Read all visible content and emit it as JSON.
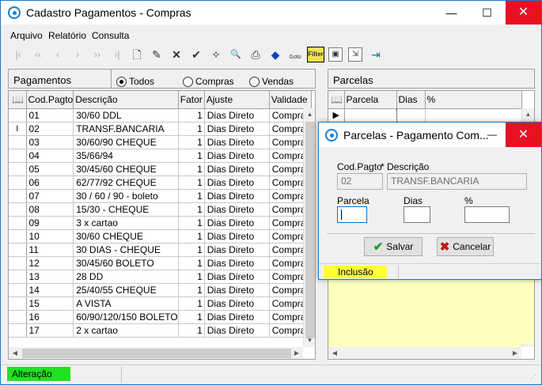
{
  "window": {
    "title": "Cadastro Pagamentos - Compras",
    "min": "—",
    "max": "☐",
    "close": "✕"
  },
  "menu": [
    {
      "label": "Arquivo"
    },
    {
      "label": "Relatório"
    },
    {
      "label": "Consulta"
    }
  ],
  "toolbar": [
    {
      "icon": "first-record-icon",
      "glyph": "|‹"
    },
    {
      "icon": "prev-page-icon",
      "glyph": "‹‹"
    },
    {
      "icon": "prev-record-icon",
      "glyph": "‹"
    },
    {
      "icon": "next-record-icon",
      "glyph": "›"
    },
    {
      "icon": "next-page-icon",
      "glyph": "››"
    },
    {
      "icon": "last-record-icon",
      "glyph": "›|"
    },
    {
      "icon": "new-icon",
      "glyph": "🗋"
    },
    {
      "icon": "edit-icon",
      "glyph": "✎"
    },
    {
      "icon": "delete-icon",
      "glyph": "✕"
    },
    {
      "icon": "save-icon",
      "glyph": "✔"
    },
    {
      "icon": "wand-icon",
      "glyph": "✧"
    },
    {
      "icon": "preview-icon",
      "glyph": "🔍"
    },
    {
      "icon": "print-icon",
      "glyph": "⎙"
    },
    {
      "icon": "eraser-icon",
      "glyph": "◆"
    },
    {
      "icon": "goto-icon",
      "glyph": "Goto"
    },
    {
      "icon": "filter-icon",
      "glyph": "Filter"
    },
    {
      "icon": "image-icon",
      "glyph": "▣"
    },
    {
      "icon": "export-icon",
      "glyph": "⇲"
    },
    {
      "icon": "exit-icon",
      "glyph": "⇥"
    }
  ],
  "pagamentos": {
    "label": "Pagamentos",
    "radios": [
      {
        "label": "Todos",
        "selected": true
      },
      {
        "label": "Compras",
        "selected": false
      },
      {
        "label": "Vendas",
        "selected": false
      }
    ],
    "columns": [
      "Cod.Pagto",
      "Descrição",
      "Fator",
      "Ajuste",
      "Validade"
    ],
    "rows": [
      {
        "cod": "01",
        "desc": "30/60 DDL",
        "fator": "1",
        "ajuste": "Dias Direto",
        "validade": "Compras",
        "ind": ""
      },
      {
        "cod": "02",
        "desc": "TRANSF.BANCARIA",
        "fator": "1",
        "ajuste": "Dias Direto",
        "validade": "Compras",
        "ind": "I"
      },
      {
        "cod": "03",
        "desc": "30/60/90 CHEQUE",
        "fator": "1",
        "ajuste": "Dias Direto",
        "validade": "Compras",
        "ind": ""
      },
      {
        "cod": "04",
        "desc": "35/66/94",
        "fator": "1",
        "ajuste": "Dias Direto",
        "validade": "Compras",
        "ind": ""
      },
      {
        "cod": "05",
        "desc": "30/45/60 CHEQUE",
        "fator": "1",
        "ajuste": "Dias Direto",
        "validade": "Compras",
        "ind": ""
      },
      {
        "cod": "06",
        "desc": "62/77/92 CHEQUE",
        "fator": "1",
        "ajuste": "Dias Direto",
        "validade": "Compras",
        "ind": ""
      },
      {
        "cod": "07",
        "desc": "30 / 60 / 90 - boleto",
        "fator": "1",
        "ajuste": "Dias Direto",
        "validade": "Compras",
        "ind": ""
      },
      {
        "cod": "08",
        "desc": "15/30 - CHEQUE",
        "fator": "1",
        "ajuste": "Dias Direto",
        "validade": "Compras",
        "ind": ""
      },
      {
        "cod": "09",
        "desc": "3 x cartao",
        "fator": "1",
        "ajuste": "Dias Direto",
        "validade": "Compras",
        "ind": ""
      },
      {
        "cod": "10",
        "desc": "30/60 CHEQUE",
        "fator": "1",
        "ajuste": "Dias Direto",
        "validade": "Compras",
        "ind": ""
      },
      {
        "cod": "11",
        "desc": "30 DIAS - CHEQUE",
        "fator": "1",
        "ajuste": "Dias Direto",
        "validade": "Compras",
        "ind": ""
      },
      {
        "cod": "12",
        "desc": "30/45/60 BOLETO",
        "fator": "1",
        "ajuste": "Dias Direto",
        "validade": "Compras",
        "ind": ""
      },
      {
        "cod": "13",
        "desc": "28 DD",
        "fator": "1",
        "ajuste": "Dias Direto",
        "validade": "Compras",
        "ind": ""
      },
      {
        "cod": "14",
        "desc": "25/40/55 CHEQUE",
        "fator": "1",
        "ajuste": "Dias Direto",
        "validade": "Compras",
        "ind": ""
      },
      {
        "cod": "15",
        "desc": "A VISTA",
        "fator": "1",
        "ajuste": "Dias Direto",
        "validade": "Compras",
        "ind": ""
      },
      {
        "cod": "16",
        "desc": "60/90/120/150 BOLETO",
        "fator": "1",
        "ajuste": "Dias Direto",
        "validade": "Compras",
        "ind": ""
      },
      {
        "cod": "17",
        "desc": "2 x cartao",
        "fator": "1",
        "ajuste": "Dias Direto",
        "validade": "Compras",
        "ind": ""
      }
    ]
  },
  "parcelas": {
    "label": "Parcelas",
    "columns": [
      "Parcela",
      "Dias",
      "%"
    ]
  },
  "status": {
    "main": "Alteração"
  },
  "dialog": {
    "title": "Parcelas - Pagamento Com...",
    "min": "—",
    "close": "✕",
    "cod_label": "Cod.Pagto",
    "desc_label": "* Descrição",
    "cod_value": "02",
    "desc_value": "TRANSF.BANCARIA",
    "parcela_label": "Parcela",
    "dias_label": "Dias",
    "pct_label": "%",
    "parcela_value": "",
    "dias_value": "",
    "pct_value": "",
    "save_label": "Salvar",
    "cancel_label": "Cancelar",
    "status": "Inclusão"
  },
  "colors": {
    "accent": "#1979ca",
    "status_green": "#22e022",
    "status_yellow": "#ffff33",
    "panel_yellow": "#ffffc0",
    "close_red": "#e81123"
  }
}
